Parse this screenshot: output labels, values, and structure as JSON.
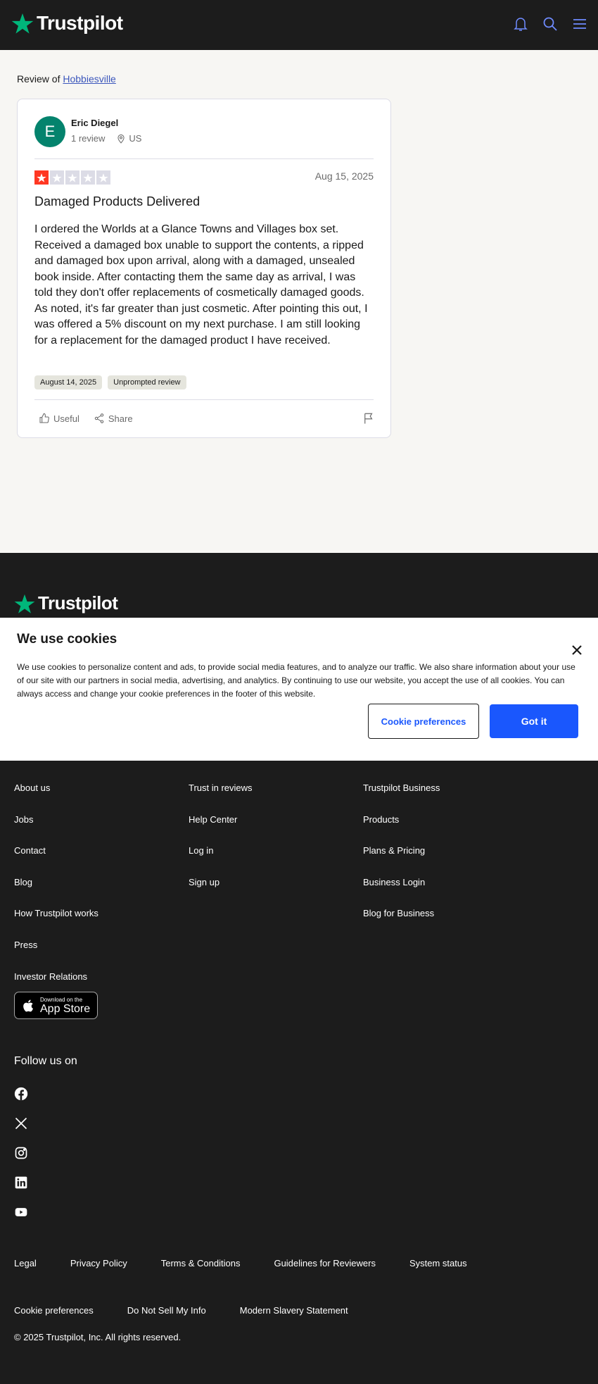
{
  "header": {
    "logo_text": "Trustpilot",
    "brand_color": "#00b67a"
  },
  "review": {
    "review_of_prefix": "Review of",
    "business_name": "Hobbiesville",
    "author_initial": "E",
    "author_name": "Eric Diegel",
    "review_count": "1 review",
    "country": "US",
    "rating": 1,
    "rating_max": 5,
    "date": "Aug 15, 2025",
    "title": "Damaged Products Delivered",
    "body": "I ordered the Worlds at a Glance Towns and Villages box set. Received a damaged box unable to support the contents, a ripped and damaged box upon arrival, along with a damaged, unsealed book inside. After contacting them the same day as arrival, I was told they don't offer replacements of cosmetically damaged goods. As noted, it's far greater than just cosmetic. After pointing this out, I was offered a 5% discount on my next purchase. I am still looking for a replacement for the damaged product I have received.",
    "experience_date": "August 14, 2025",
    "review_type": "Unprompted review",
    "useful_label": "Useful",
    "share_label": "Share",
    "star_color": "#ff3722"
  },
  "footer": {
    "logo_text": "Trustpilot",
    "col1": [
      "About us",
      "Jobs",
      "Contact",
      "Blog",
      "How Trustpilot works",
      "Press",
      "Investor Relations"
    ],
    "col2": [
      "Trust in reviews",
      "Help Center",
      "Log in",
      "Sign up"
    ],
    "col3": [
      "Trustpilot Business",
      "Products",
      "Plans & Pricing",
      "Business Login",
      "Blog for Business"
    ],
    "app_store_line1": "Download on the",
    "app_store_line2": "App Store",
    "follow_label": "Follow us on",
    "social_icons": [
      "facebook-icon",
      "x-icon",
      "instagram-icon",
      "linkedin-icon",
      "youtube-icon"
    ],
    "legal_links": [
      "Legal",
      "Privacy Policy",
      "Terms & Conditions",
      "Guidelines for Reviewers",
      "System status",
      "Cookie preferences",
      "Do Not Sell My Info",
      "Modern Slavery Statement"
    ],
    "copyright": "© 2025 Trustpilot, Inc. All rights reserved."
  },
  "cookie_banner": {
    "title": "We use cookies",
    "text": "We use cookies to personalize content and ads, to provide social media features, and to analyze our traffic. We also share information about your use of our site with our partners in social media, advertising, and analytics. By continuing to use our website, you accept the use of all cookies. You can always access and change your cookie preferences in the footer of this website.",
    "preferences_label": "Cookie preferences",
    "accept_label": "Got it",
    "accent_color": "#1a57fd"
  }
}
